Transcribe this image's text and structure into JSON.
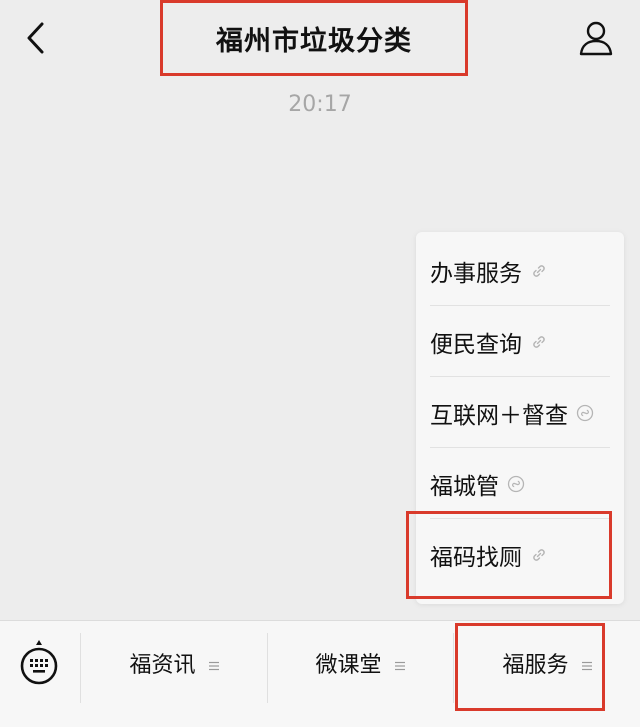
{
  "header": {
    "title": "福州市垃圾分类"
  },
  "time": "20:17",
  "menu": {
    "items": [
      {
        "label": "办事服务",
        "icon": "link-icon"
      },
      {
        "label": "便民查询",
        "icon": "link-icon"
      },
      {
        "label": "互联网＋督查",
        "icon": "mini-program-icon"
      },
      {
        "label": "福城管",
        "icon": "mini-program-icon"
      },
      {
        "label": "福码找厕",
        "icon": "link-icon"
      }
    ]
  },
  "bottom_bar": {
    "tabs": [
      {
        "label": "福资讯"
      },
      {
        "label": "微课堂"
      },
      {
        "label": "福服务"
      }
    ]
  },
  "colors": {
    "highlight": "#d93a2b",
    "background": "#ededed",
    "menu_bg": "#f7f7f7",
    "time_text": "#a6a6a6"
  }
}
